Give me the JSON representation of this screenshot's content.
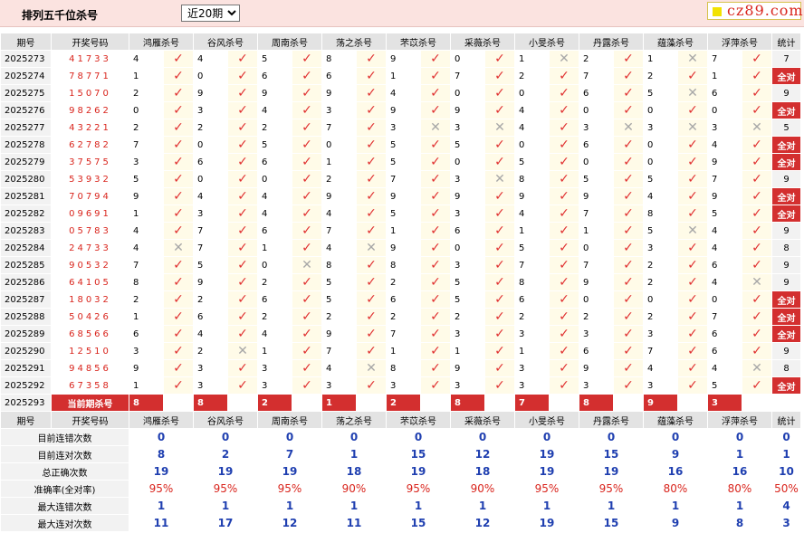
{
  "header": {
    "title": "排列五千位杀号",
    "select_value": "近20期",
    "logo_text": "cz89.com"
  },
  "columns": {
    "issue": "期号",
    "draw": "开奖号码",
    "experts": [
      "鸿雁杀号",
      "谷风杀号",
      "周南杀号",
      "荡之杀号",
      "芣苡杀号",
      "采薇杀号",
      "小旻杀号",
      "丹露杀号",
      "蕴藻杀号",
      "浮萍杀号"
    ],
    "stat": "统计"
  },
  "rows": [
    {
      "issue": "2025273",
      "draw": "41733",
      "kills": [
        4,
        4,
        5,
        8,
        9,
        0,
        1,
        2,
        1,
        7
      ],
      "hits": [
        1,
        1,
        1,
        1,
        1,
        1,
        0,
        1,
        0,
        1
      ],
      "stat": "7"
    },
    {
      "issue": "2025274",
      "draw": "78771",
      "kills": [
        1,
        0,
        6,
        6,
        1,
        7,
        2,
        7,
        2,
        1
      ],
      "hits": [
        1,
        1,
        1,
        1,
        1,
        1,
        1,
        1,
        1,
        1
      ],
      "stat": "全对"
    },
    {
      "issue": "2025275",
      "draw": "15070",
      "kills": [
        2,
        9,
        9,
        9,
        4,
        0,
        0,
        6,
        5,
        6
      ],
      "hits": [
        1,
        1,
        1,
        1,
        1,
        1,
        1,
        1,
        0,
        1
      ],
      "stat": "9"
    },
    {
      "issue": "2025276",
      "draw": "98262",
      "kills": [
        0,
        3,
        4,
        3,
        9,
        9,
        4,
        0,
        0,
        0
      ],
      "hits": [
        1,
        1,
        1,
        1,
        1,
        1,
        1,
        1,
        1,
        1
      ],
      "stat": "全对"
    },
    {
      "issue": "2025277",
      "draw": "43221",
      "kills": [
        2,
        2,
        2,
        7,
        3,
        3,
        4,
        3,
        3,
        3
      ],
      "hits": [
        1,
        1,
        1,
        1,
        0,
        0,
        1,
        0,
        0,
        0
      ],
      "stat": "5"
    },
    {
      "issue": "2025278",
      "draw": "62782",
      "kills": [
        7,
        0,
        5,
        0,
        5,
        5,
        0,
        6,
        0,
        4
      ],
      "hits": [
        1,
        1,
        1,
        1,
        1,
        1,
        1,
        1,
        1,
        1
      ],
      "stat": "全对"
    },
    {
      "issue": "2025279",
      "draw": "37575",
      "kills": [
        3,
        6,
        6,
        1,
        5,
        0,
        5,
        0,
        0,
        9
      ],
      "hits": [
        1,
        1,
        1,
        1,
        1,
        1,
        1,
        1,
        1,
        1
      ],
      "stat": "全对"
    },
    {
      "issue": "2025280",
      "draw": "53932",
      "kills": [
        5,
        0,
        0,
        2,
        7,
        3,
        8,
        5,
        5,
        7
      ],
      "hits": [
        1,
        1,
        1,
        1,
        1,
        0,
        1,
        1,
        1,
        1
      ],
      "stat": "9"
    },
    {
      "issue": "2025281",
      "draw": "70794",
      "kills": [
        9,
        4,
        4,
        9,
        9,
        9,
        9,
        9,
        4,
        9
      ],
      "hits": [
        1,
        1,
        1,
        1,
        1,
        1,
        1,
        1,
        1,
        1
      ],
      "stat": "全对"
    },
    {
      "issue": "2025282",
      "draw": "09691",
      "kills": [
        1,
        3,
        4,
        4,
        5,
        3,
        4,
        7,
        8,
        5
      ],
      "hits": [
        1,
        1,
        1,
        1,
        1,
        1,
        1,
        1,
        1,
        1
      ],
      "stat": "全对"
    },
    {
      "issue": "2025283",
      "draw": "05783",
      "kills": [
        4,
        7,
        6,
        7,
        1,
        6,
        1,
        1,
        5,
        4
      ],
      "hits": [
        1,
        1,
        1,
        1,
        1,
        1,
        1,
        1,
        0,
        1
      ],
      "stat": "9"
    },
    {
      "issue": "2025284",
      "draw": "24733",
      "kills": [
        4,
        7,
        1,
        4,
        9,
        0,
        5,
        0,
        3,
        4
      ],
      "hits": [
        0,
        1,
        1,
        0,
        1,
        1,
        1,
        1,
        1,
        1
      ],
      "stat": "8"
    },
    {
      "issue": "2025285",
      "draw": "90532",
      "kills": [
        7,
        5,
        0,
        8,
        8,
        3,
        7,
        7,
        2,
        6
      ],
      "hits": [
        1,
        1,
        0,
        1,
        1,
        1,
        1,
        1,
        1,
        1
      ],
      "stat": "9"
    },
    {
      "issue": "2025286",
      "draw": "64105",
      "kills": [
        8,
        9,
        2,
        5,
        2,
        5,
        8,
        9,
        2,
        4
      ],
      "hits": [
        1,
        1,
        1,
        1,
        1,
        1,
        1,
        1,
        1,
        0
      ],
      "stat": "9"
    },
    {
      "issue": "2025287",
      "draw": "18032",
      "kills": [
        2,
        2,
        6,
        5,
        6,
        5,
        6,
        0,
        0,
        0
      ],
      "hits": [
        1,
        1,
        1,
        1,
        1,
        1,
        1,
        1,
        1,
        1
      ],
      "stat": "全对"
    },
    {
      "issue": "2025288",
      "draw": "50426",
      "kills": [
        1,
        6,
        2,
        2,
        2,
        2,
        2,
        2,
        2,
        7
      ],
      "hits": [
        1,
        1,
        1,
        1,
        1,
        1,
        1,
        1,
        1,
        1
      ],
      "stat": "全对"
    },
    {
      "issue": "2025289",
      "draw": "68566",
      "kills": [
        6,
        4,
        4,
        9,
        7,
        3,
        3,
        3,
        3,
        6
      ],
      "hits": [
        1,
        1,
        1,
        1,
        1,
        1,
        1,
        1,
        1,
        1
      ],
      "stat": "全对"
    },
    {
      "issue": "2025290",
      "draw": "12510",
      "kills": [
        3,
        2,
        1,
        7,
        1,
        1,
        1,
        6,
        7,
        6
      ],
      "hits": [
        1,
        0,
        1,
        1,
        1,
        1,
        1,
        1,
        1,
        1
      ],
      "stat": "9"
    },
    {
      "issue": "2025291",
      "draw": "94856",
      "kills": [
        9,
        3,
        3,
        4,
        8,
        9,
        3,
        9,
        4,
        4
      ],
      "hits": [
        1,
        1,
        1,
        0,
        1,
        1,
        1,
        1,
        1,
        0
      ],
      "stat": "8"
    },
    {
      "issue": "2025292",
      "draw": "67358",
      "kills": [
        1,
        3,
        3,
        3,
        3,
        3,
        3,
        3,
        3,
        5
      ],
      "hits": [
        1,
        1,
        1,
        1,
        1,
        1,
        1,
        1,
        1,
        1
      ],
      "stat": "全对"
    }
  ],
  "current": {
    "issue": "2025293",
    "label": "当前期杀号",
    "kills": [
      "8",
      "8",
      "2",
      "1",
      "2",
      "8",
      "7",
      "8",
      "9",
      "3"
    ]
  },
  "stats": [
    {
      "label": "目前连错次数",
      "values": [
        "0",
        "0",
        "0",
        "0",
        "0",
        "0",
        "0",
        "0",
        "0",
        "0",
        "0"
      ]
    },
    {
      "label": "目前连对次数",
      "values": [
        "8",
        "2",
        "7",
        "1",
        "15",
        "12",
        "19",
        "15",
        "9",
        "1",
        "1"
      ]
    },
    {
      "label": "总正确次数",
      "values": [
        "19",
        "19",
        "19",
        "18",
        "19",
        "18",
        "19",
        "19",
        "16",
        "16",
        "10"
      ]
    },
    {
      "label": "准确率(全对率)",
      "values": [
        "95%",
        "95%",
        "95%",
        "90%",
        "95%",
        "90%",
        "95%",
        "95%",
        "80%",
        "80%",
        "50%"
      ]
    },
    {
      "label": "最大连错次数",
      "values": [
        "1",
        "1",
        "1",
        "1",
        "1",
        "1",
        "1",
        "1",
        "1",
        "1",
        "4"
      ]
    },
    {
      "label": "最大连对次数",
      "values": [
        "11",
        "17",
        "12",
        "11",
        "15",
        "12",
        "19",
        "15",
        "9",
        "8",
        "3"
      ]
    }
  ],
  "symbols": {
    "ok": "✓",
    "no": "✕"
  },
  "colors": {
    "accent": "#d32f2f",
    "header_bg": "#fbe3e0",
    "stat_blue": "#1f3fb0"
  }
}
